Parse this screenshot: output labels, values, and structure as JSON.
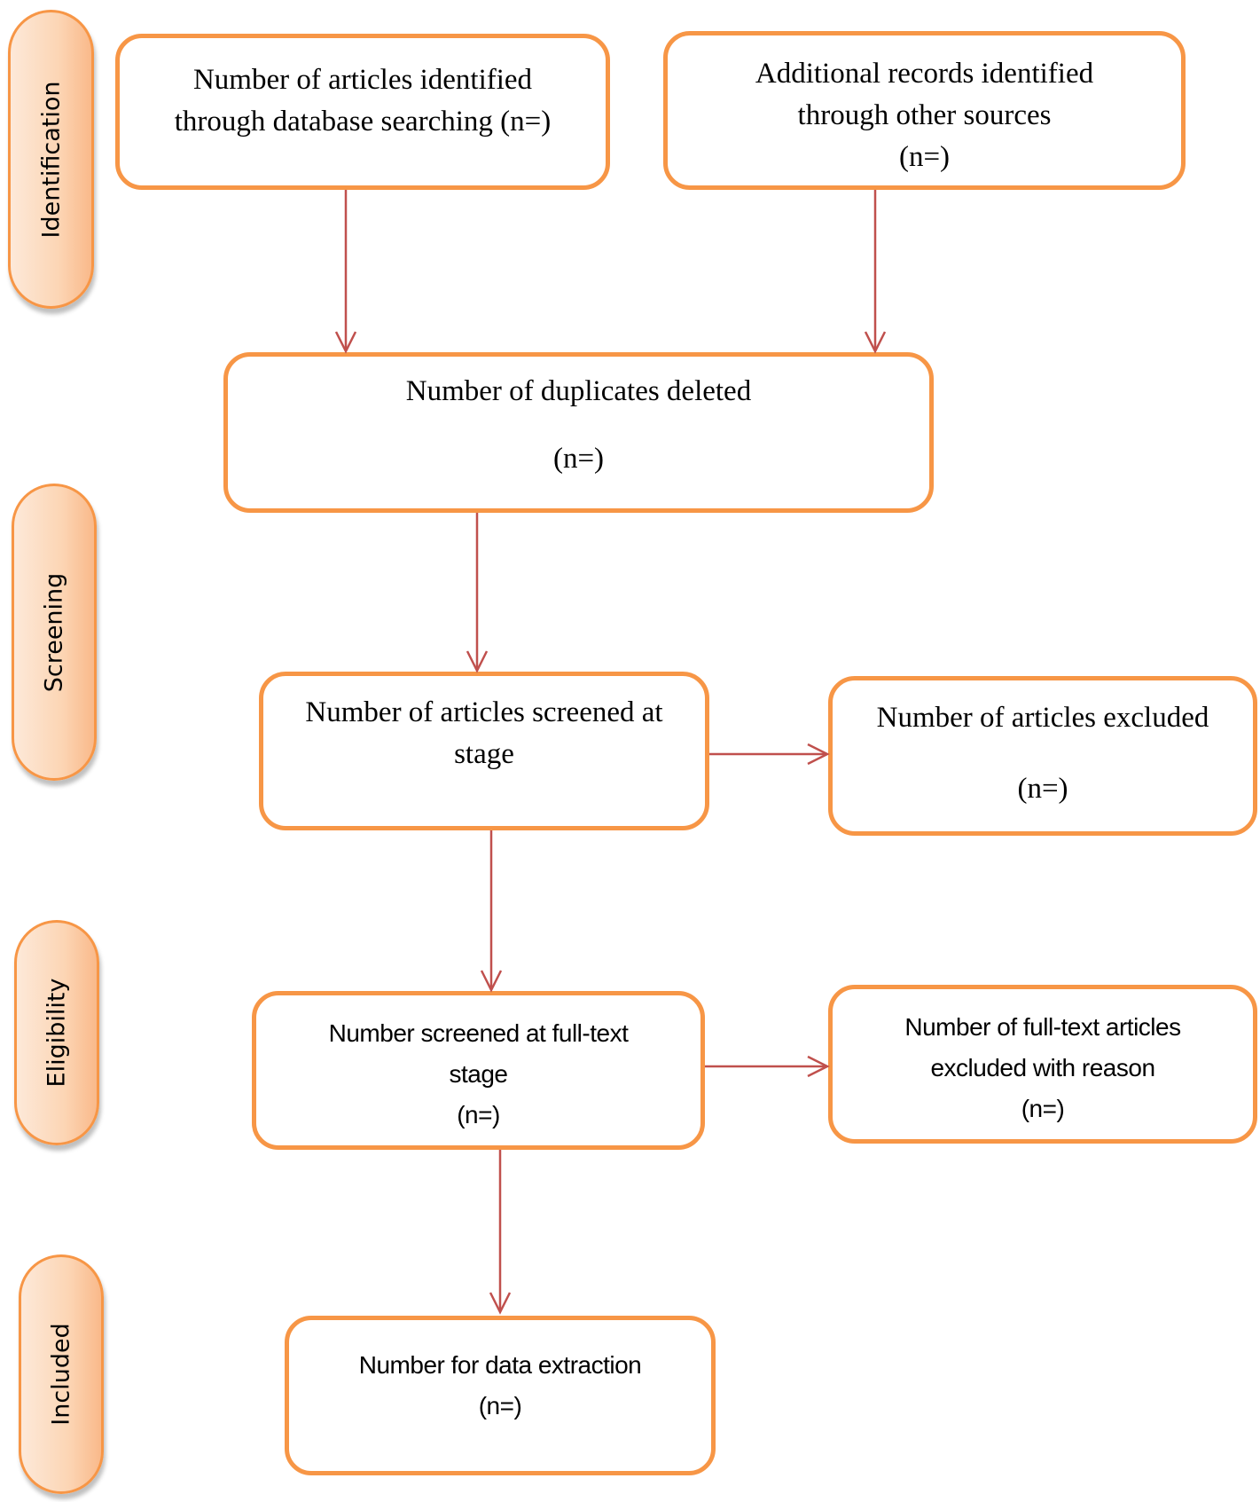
{
  "stages": [
    {
      "id": "identification",
      "label": "Identification"
    },
    {
      "id": "screening",
      "label": "Screening"
    },
    {
      "id": "eligibility",
      "label": "Eligibility"
    },
    {
      "id": "included",
      "label": "Included"
    }
  ],
  "boxes": {
    "database_search": {
      "lines": [
        "Number of articles identified",
        "through database searching (n=)"
      ]
    },
    "other_sources": {
      "lines": [
        "Additional records identified",
        "through other sources",
        "(n=)"
      ]
    },
    "duplicates": {
      "lines": [
        "Number of duplicates deleted",
        "",
        "(n=)"
      ]
    },
    "screened": {
      "lines": [
        "Number of articles screened at",
        "stage"
      ]
    },
    "excluded": {
      "lines": [
        "Number of articles excluded",
        "",
        "(n=)"
      ]
    },
    "fulltext": {
      "lines": [
        "Number  screened at full-text",
        "stage",
        "(n=)"
      ]
    },
    "fulltext_excluded": {
      "lines": [
        "Number of full-text articles",
        "excluded with reason",
        "(n=)"
      ]
    },
    "extraction": {
      "lines": [
        "Number for data extraction",
        "(n=)"
      ]
    }
  },
  "colors": {
    "box_border": "#f79646",
    "arrow": "#c0504d",
    "pill_fill": "#fcd5b4"
  }
}
